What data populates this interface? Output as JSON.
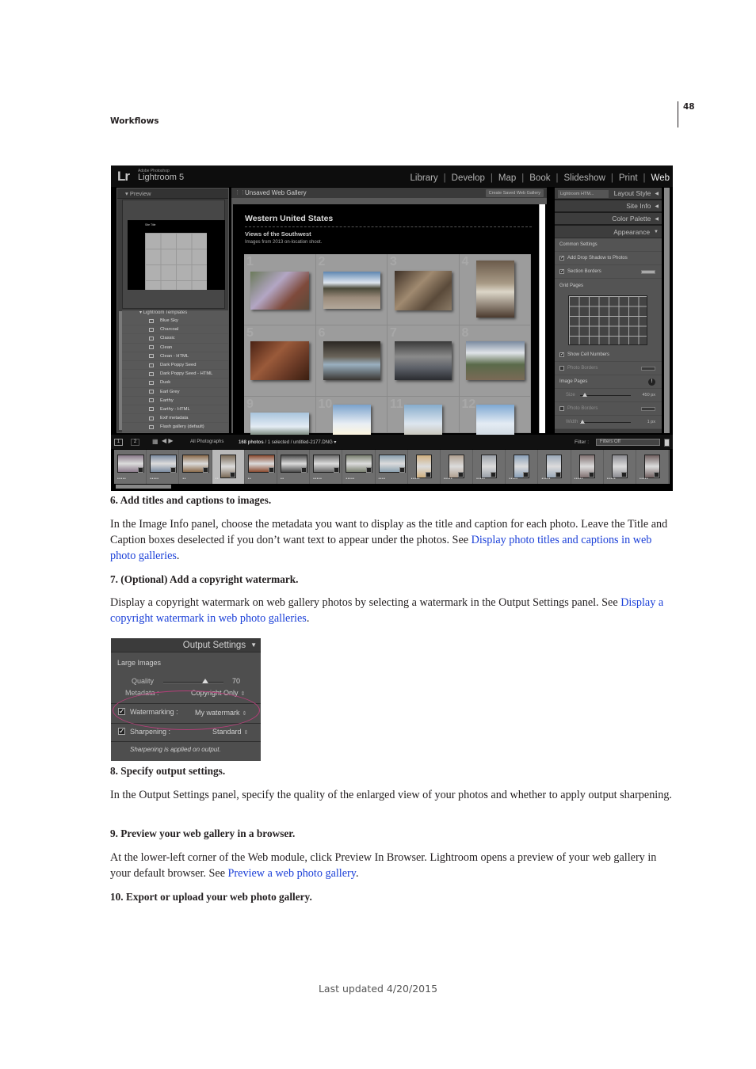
{
  "header": {
    "section": "Workflows",
    "page_number": "48"
  },
  "lightroom": {
    "logo": "Lr",
    "product_small": "Adobe Photoshop",
    "product": "Lightroom 5",
    "modules": [
      "Library",
      "Develop",
      "Map",
      "Book",
      "Slideshow",
      "Print",
      "Web"
    ],
    "active_module": "Web",
    "left_panel": {
      "preview_label": "Preview",
      "preview_title": "Site Title",
      "templates_folder": "Lightroom Templates",
      "templates": [
        "Blue Sky",
        "Charcoal",
        "Classic",
        "Clean",
        "Clean - HTML",
        "Dark Poppy Seed",
        "Dark Poppy Seed - HTML",
        "Dusk",
        "Earl Grey",
        "Earthy",
        "Earthy - HTML",
        "Exif metadata",
        "Flash gallery (default)"
      ]
    },
    "center": {
      "gallery_name": "Unsaved Web Gallery",
      "create_button": "Create Saved Web Gallery",
      "site_title": "Western United States",
      "collection_title": "Views of the Southwest",
      "collection_description": "Images from 2013 on-location shoot.",
      "cell_numbers": [
        "1",
        "2",
        "3",
        "4",
        "5",
        "6",
        "7",
        "8",
        "9",
        "10",
        "11",
        "12"
      ]
    },
    "right_panel": {
      "layout_preset": "Lightroom HTM...",
      "sections": {
        "layout_style": "Layout Style",
        "site_info": "Site Info",
        "color_palette": "Color Palette",
        "appearance": "Appearance"
      },
      "common_settings": "Common Settings",
      "add_drop_shadow": {
        "label": "Add Drop Shadow to Photos",
        "checked": true
      },
      "section_borders": {
        "label": "Section Borders",
        "checked": true
      },
      "grid_pages": "Grid Pages",
      "show_cell_numbers": {
        "label": "Show Cell Numbers",
        "checked": true
      },
      "photo_borders_grid": {
        "label": "Photo Borders",
        "checked": false
      },
      "image_pages": "Image Pages",
      "size": {
        "label": "Size",
        "value": "450 px",
        "fraction": 0.1
      },
      "photo_borders_image": {
        "label": "Photo Borders",
        "checked": false
      },
      "width": {
        "label": "Width",
        "value": "1 px",
        "fraction": 0.05
      }
    },
    "bottom_bar": {
      "page1": "1",
      "page2": "2",
      "source": "All Photographs",
      "count_bold": "168 photos",
      "count_rest": " / 1 selected / untitled-2177.DNG ▾",
      "filter_label": "Filter :",
      "filter_value": "Filters Off"
    },
    "filmstrip": [
      {
        "stars": "•••••"
      },
      {
        "stars": "•••••"
      },
      {
        "stars": "••"
      },
      {
        "stars": "••",
        "selected": true
      },
      {
        "stars": "••"
      },
      {
        "stars": "••"
      },
      {
        "stars": "•••••"
      },
      {
        "stars": "•••••"
      },
      {
        "stars": "••••"
      },
      {
        "stars": "•••••"
      },
      {
        "stars": "•••••"
      },
      {
        "stars": "•••••"
      },
      {
        "stars": "•••••"
      },
      {
        "stars": "•••••"
      },
      {
        "stars": "•••••"
      },
      {
        "stars": "•••••"
      },
      {
        "stars": "•••••"
      }
    ]
  },
  "steps": [
    {
      "heading": "6. Add titles and captions to images.",
      "text": "In the Image Info panel, choose the metadata you want to display as the title and caption for each photo. Leave the Title and Caption boxes deselected if you don’t want text to appear under the photos. See ",
      "link": "Display photo titles and captions in web photo galleries",
      "after": "."
    },
    {
      "heading": "7. (Optional) Add a copyright watermark.",
      "text": "Display a copyright watermark on web gallery photos by selecting a watermark in the Output Settings panel. See ",
      "link": "Display a copyright watermark in web photo galleries",
      "after": "."
    },
    {
      "heading": "8. Specify output settings.",
      "text": "In the Output Settings panel, specify the quality of the enlarged view of your photos and whether to apply output sharpening."
    },
    {
      "heading": "9. Preview your web gallery in a browser.",
      "text": "At the lower-left corner of the Web module, click Preview In Browser. Lightroom opens a preview of your web gallery in your default browser. See ",
      "link": "Preview a web photo gallery",
      "after": "."
    },
    {
      "heading": "10. Export or upload your web photo gallery."
    }
  ],
  "output_settings": {
    "title": "Output Settings",
    "large_images": "Large Images",
    "quality_label": "Quality",
    "quality_value": "70",
    "quality_fraction": 0.7,
    "metadata_label": "Metadata :",
    "metadata_value": "Copyright Only",
    "watermarking_label": "Watermarking :",
    "watermarking_value": "My watermark",
    "watermarking_checked": true,
    "sharpening_label": "Sharpening :",
    "sharpening_value": "Standard",
    "sharpening_checked": true,
    "note": "Sharpening is applied on output.",
    "highlight_color": "#b43f79"
  },
  "footer": {
    "last_updated": "Last updated 4/20/2015"
  }
}
